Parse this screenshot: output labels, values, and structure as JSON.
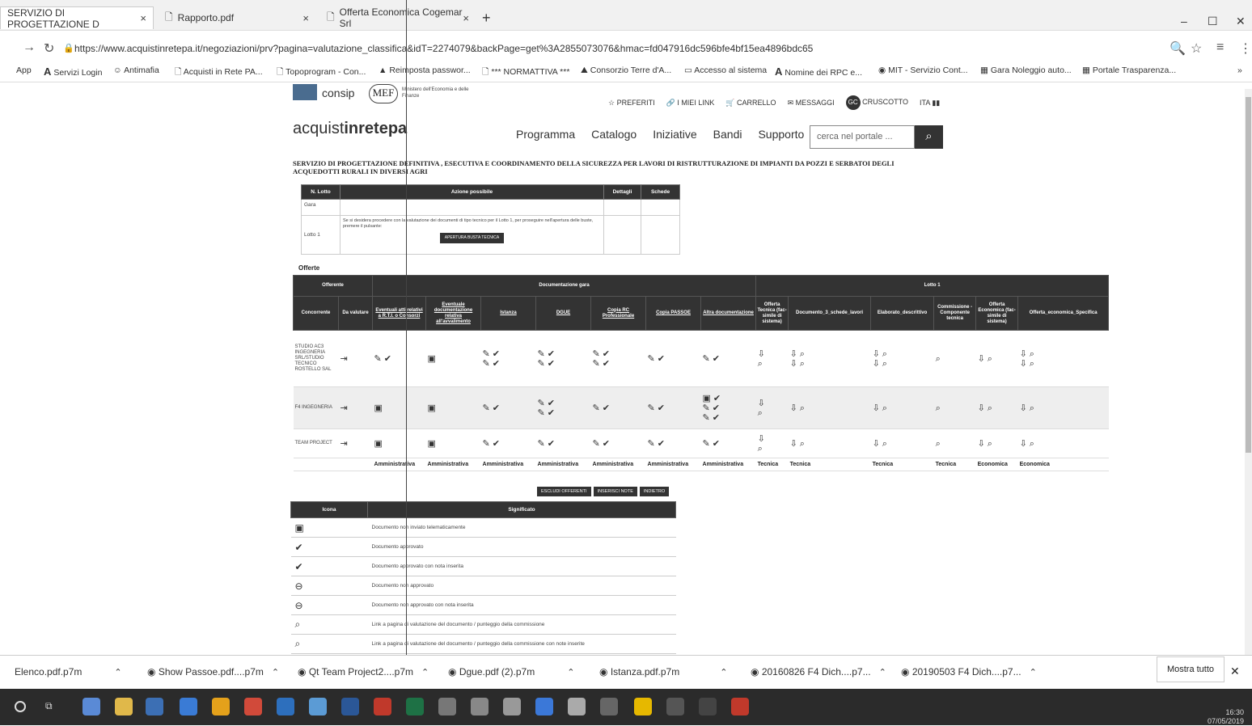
{
  "browser": {
    "tabs": [
      {
        "title": "SERVIZIO DI PROGETTAZIONE D",
        "close": "×"
      },
      {
        "title": "Rapporto.pdf",
        "close": "×"
      },
      {
        "title": "Offerta Economica Cogemar Srl",
        "close": "×"
      }
    ],
    "new_tab": "+",
    "window": {
      "minimize": "–",
      "maximize": "☐",
      "close": "✕"
    },
    "url": "https://www.acquistinretepa.it/negoziazioni/prv?pagina=valutazione_classifica&idT=2274079&backPage=get%3A2855073076&hmac=fd047916dc596bfe4bf15ea4896bdc65",
    "bookmarks": [
      "App",
      "Servizi Login",
      "Antimafia",
      "Acquisti in Rete PA...",
      "Topoprogram - Con...",
      "Reimposta passwor...",
      "*** NORMATTIVA ***",
      "Consorzio Terre d'A...",
      "Accesso al sistema",
      "Nomine dei RPC e...",
      "MIT - Servizio Cont...",
      "Gara Noleggio auto...",
      "Portale Trasparenza..."
    ],
    "bookmarks_more": "»"
  },
  "site": {
    "logo_text": "consip",
    "mef": "MEF",
    "mef_sub": "Ministero dell'Economia e delle Finanze",
    "top_links": [
      "PREFERITI",
      "I MIEI LINK",
      "CARRELLO",
      "MESSAGGI",
      "CRUSCOTTO",
      "ITA"
    ],
    "user_initials": "GC",
    "brand_light": "acquist",
    "brand_bold": "inrete",
    "brand_tail": "pa",
    "menu": [
      "Programma",
      "Catalogo",
      "Iniziative",
      "Bandi",
      "Supporto"
    ],
    "search_placeholder": "cerca nel portale ..."
  },
  "page": {
    "title": "SERVIZIO DI PROGETTAZIONE DEFINITIVA , ESECUTIVA E COORDINAMENTO DELLA SICUREZZA PER LAVORI DI RISTRUTTURAZIONE DI IMPIANTI DA POZZI E SERBATOI DEGLI ACQUEDOTTI RURALI IN DIVERSI AGRI",
    "lotti_headers": [
      "N. Lotto",
      "Azione possibile",
      "Dettagli",
      "Schede"
    ],
    "lotti_rows": [
      {
        "lotto": "Gara",
        "azione": ""
      },
      {
        "lotto": "Lotto 1",
        "azione": "Se si desidera procedere con la valutazione dei documenti di tipo tecnico per il Lotto 1, per proseguire nell'apertura delle buste, premere il pulsante:"
      }
    ],
    "open_button": "APERTURA BUSTA TECNICA",
    "offerte_label": "Offerte",
    "group_headers": {
      "offerente": "Offerente",
      "documentazione": "Documentazione gara",
      "lotto": "Lotto 1"
    },
    "col_headers": [
      "Concorrente",
      "Da valutare",
      "Eventuali atti relativi a R.T.I. o Consorzi",
      "Eventuale documentazione relativa all'avvalimento",
      "Istanza",
      "DGUE",
      "Copia RC Professionale",
      "Copia PASSOE",
      "Altra documentazione",
      "Offerta Tecnica (fac-simile di sistema)",
      "Documento_3_schede_lavori",
      "Elaborato_descrittivo",
      "Commissione - Componente tecnica",
      "Offerta Economica (fac-simile di sistema)",
      "Offerta_economica_Specifica"
    ],
    "offerenti": [
      {
        "name": "STUDIO AC3 INGEGNERIA SRL/STUDIO TECNICO ROSTELLO SAL"
      },
      {
        "name": "F4 INGEGNERIA"
      },
      {
        "name": "TEAM PROJECT"
      }
    ],
    "footer_types": [
      "",
      "",
      "Amministrativa",
      "Amministrativa",
      "Amministrativa",
      "Amministrativa",
      "Amministrativa",
      "Amministrativa",
      "Amministrativa",
      "Tecnica",
      "Tecnica",
      "Tecnica",
      "Tecnica",
      "Economica",
      "Economica"
    ],
    "actions": [
      "ESCLUDI OFFERENTI",
      "INSERISCI NOTE",
      "INDIETRO"
    ],
    "legend_headers": [
      "Icona",
      "Significato"
    ],
    "legend": [
      {
        "icon": "not-sent-icon",
        "text": "Documento non inviato telematicamente"
      },
      {
        "icon": "approved-icon",
        "text": "Documento approvato"
      },
      {
        "icon": "approved-note-icon",
        "text": "Documento approvato con nota inserita"
      },
      {
        "icon": "rejected-icon",
        "text": "Documento non approvato"
      },
      {
        "icon": "rejected-note-icon",
        "text": "Documento non approvato con nota inserita"
      },
      {
        "icon": "evaluate-icon",
        "text": "Link a pagina di valutazione del documento / punteggio della commissione"
      },
      {
        "icon": "evaluate-note-icon",
        "text": "Link a pagina di valutazione del documento / punteggio della commissione con note inserite"
      }
    ]
  },
  "downloads": {
    "items": [
      "Elenco.pdf.p7m",
      "Show Passoe.pdf....p7m",
      "Qt Team Project2....p7m",
      "Dgue.pdf (2).p7m",
      "Istanza.pdf.p7m",
      "20160826 F4 Dich....p7...",
      "20190503 F4 Dich....p7..."
    ],
    "show_all": "Mostra tutto",
    "close": "✕"
  },
  "taskbar": {
    "time": "16:30",
    "date": "07/05/2019"
  }
}
